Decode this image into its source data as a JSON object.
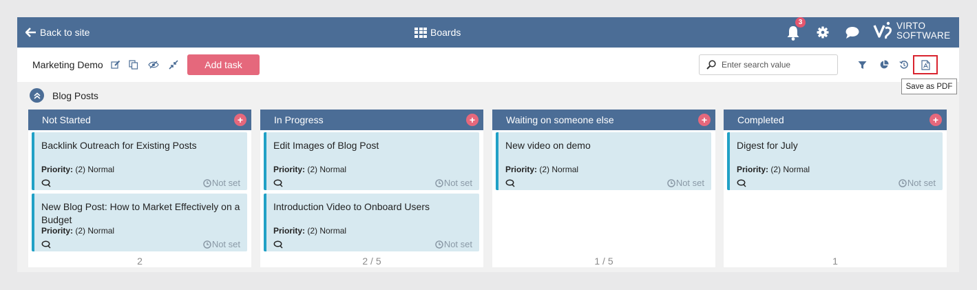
{
  "topbar": {
    "back_label": "Back to site",
    "boards_label": "Boards",
    "notification_count": "3",
    "logo_line1": "VIRTO",
    "logo_line2": "SOFTWARE"
  },
  "toolbar": {
    "board_title": "Marketing Demo",
    "add_task_label": "Add task",
    "search_placeholder": "Enter search value",
    "tooltip": "Save as PDF"
  },
  "group": {
    "title": "Blog Posts"
  },
  "columns": [
    {
      "title": "Not Started",
      "count": "2",
      "cards": [
        {
          "title": "Backlink Outreach for Existing Posts",
          "priority_label": "Priority:",
          "priority": "(2) Normal",
          "date": "Not set"
        },
        {
          "title": "New Blog Post: How to Market Effectively on a Budget",
          "priority_label": "Priority:",
          "priority": "(2) Normal",
          "date": "Not set"
        }
      ]
    },
    {
      "title": "In Progress",
      "count": "2 / 5",
      "cards": [
        {
          "title": "Edit Images of Blog Post",
          "priority_label": "Priority:",
          "priority": "(2) Normal",
          "date": "Not set"
        },
        {
          "title": "Introduction Video to Onboard Users",
          "priority_label": "Priority:",
          "priority": "(2) Normal",
          "date": "Not set"
        }
      ]
    },
    {
      "title": "Waiting on someone else",
      "count": "1 / 5",
      "cards": [
        {
          "title": "New video on demo",
          "priority_label": "Priority:",
          "priority": "(2) Normal",
          "date": "Not set"
        }
      ]
    },
    {
      "title": "Completed",
      "count": "1",
      "cards": [
        {
          "title": "Digest for July",
          "priority_label": "Priority:",
          "priority": "(2) Normal",
          "date": "Not set"
        }
      ]
    }
  ],
  "colors": {
    "header_bg": "#4b6d96",
    "accent_pink": "#e5687c",
    "card_bg": "#d7e9f0",
    "card_border": "#21a1c6",
    "highlight_red": "#d9232e"
  },
  "icons": [
    "arrow-left-icon",
    "grid-icon",
    "bell-icon",
    "gear-icon",
    "chat-icon",
    "edit-icon",
    "copy-icon",
    "hide-icon",
    "collapse-icon",
    "search-icon",
    "filter-icon",
    "pie-chart-icon",
    "history-icon",
    "pdf-icon",
    "chevron-up-icon",
    "plus-icon",
    "comment-icon",
    "clock-icon"
  ]
}
